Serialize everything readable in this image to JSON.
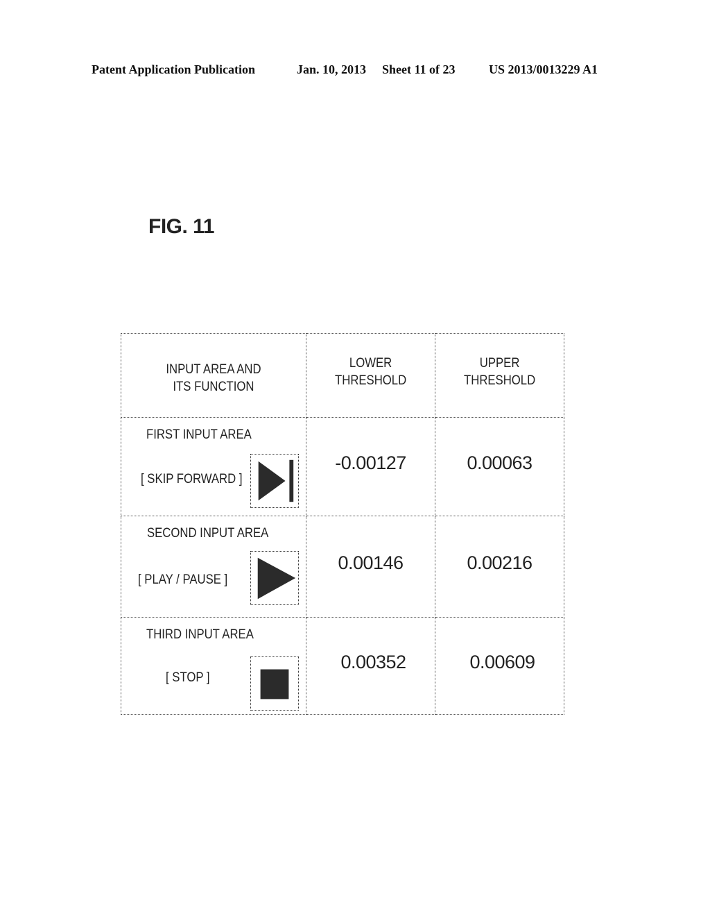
{
  "header": {
    "publication": "Patent Application Publication",
    "date": "Jan. 10, 2013",
    "sheet": "Sheet 11 of 23",
    "patent_number": "US 2013/0013229 A1"
  },
  "figure": {
    "title": "FIG. 11"
  },
  "table": {
    "columns": [
      {
        "line1": "INPUT AREA AND",
        "line2": "ITS FUNCTION"
      },
      {
        "line1": "LOWER",
        "line2": "THRESHOLD"
      },
      {
        "line1": "UPPER",
        "line2": "THRESHOLD"
      }
    ],
    "rows": [
      {
        "area": "FIRST INPUT AREA",
        "function": "[ SKIP FORWARD ]",
        "icon": "skip-forward-icon",
        "lower": "-0.00127",
        "upper": "0.00063"
      },
      {
        "area": "SECOND INPUT AREA",
        "function": "[ PLAY / PAUSE ]",
        "icon": "play-icon",
        "lower": "0.00146",
        "upper": "0.00216"
      },
      {
        "area": "THIRD INPUT AREA",
        "function": "[ STOP ]",
        "icon": "stop-icon",
        "lower": "0.00352",
        "upper": "0.00609"
      }
    ]
  },
  "colors": {
    "icon_fill": "#2b2b2b",
    "border": "#555555"
  }
}
